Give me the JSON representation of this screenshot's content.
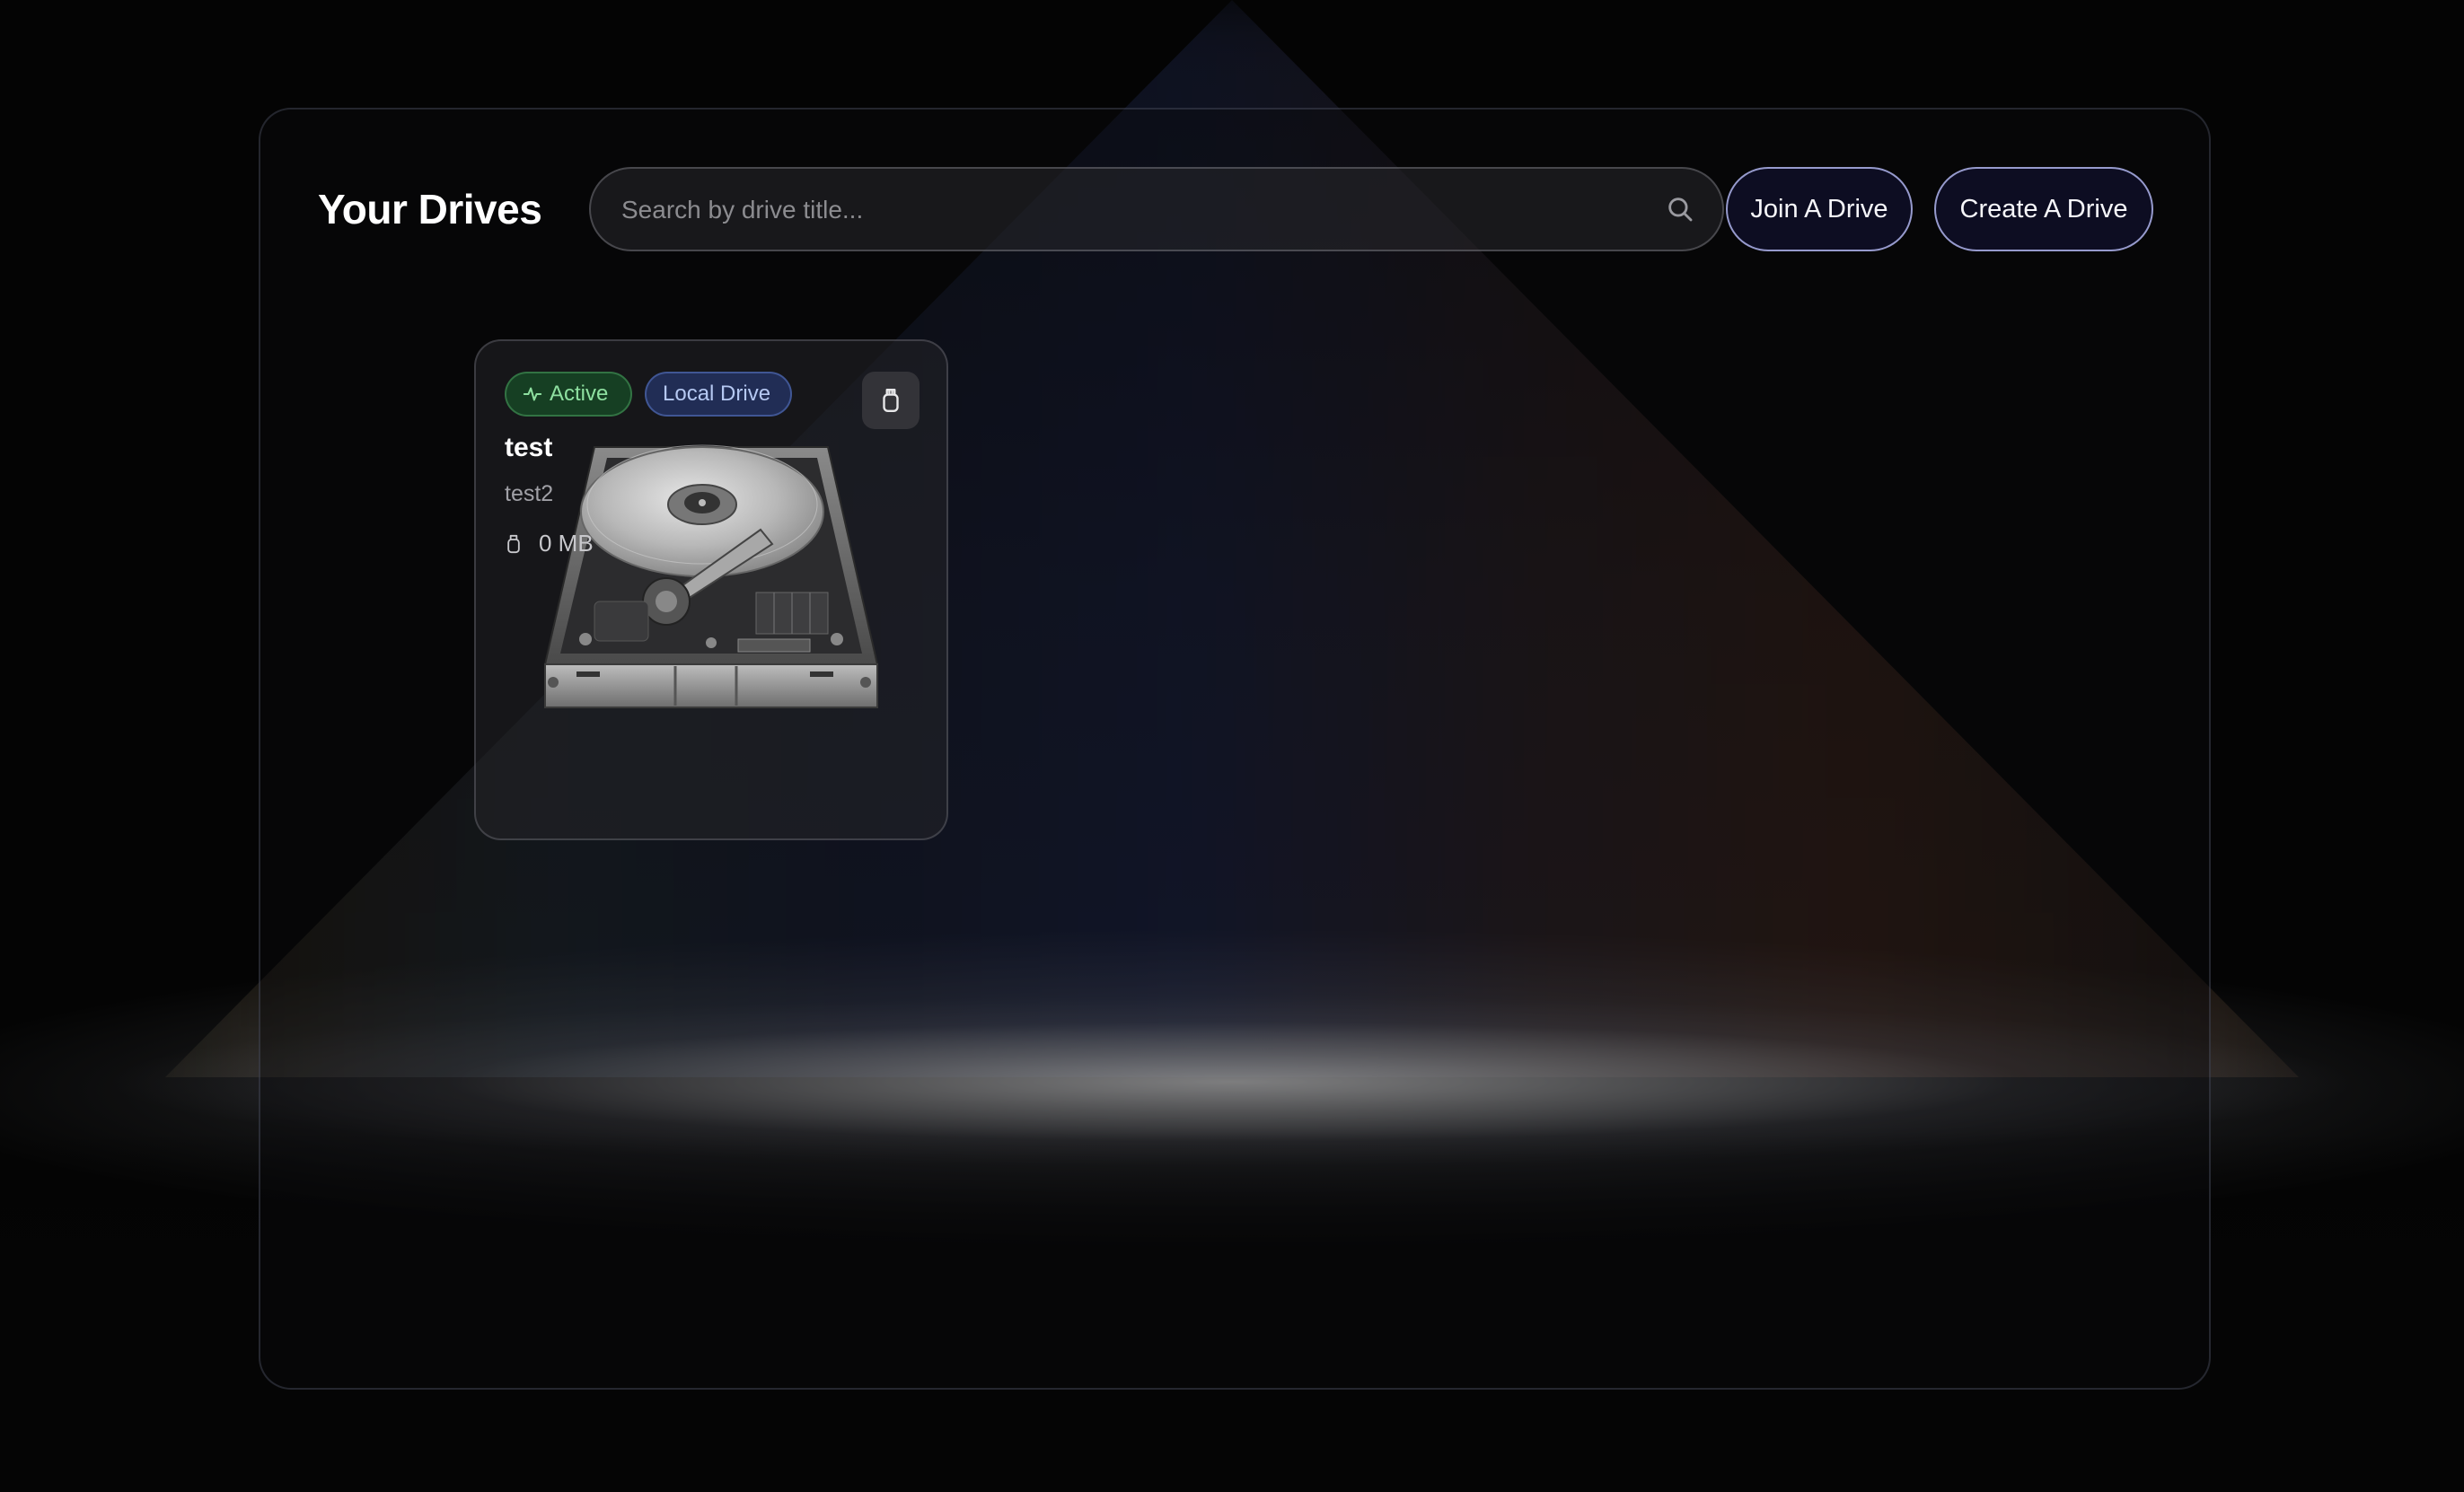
{
  "header": {
    "title": "Your Drives"
  },
  "search": {
    "placeholder": "Search by drive title..."
  },
  "buttons": {
    "join_label": "Join A Drive",
    "create_label": "Create A Drive"
  },
  "drives": [
    {
      "status": "Active",
      "type": "Local Drive",
      "title": "test",
      "description": "test2",
      "size": "0 MB",
      "icons": [
        "activity-icon",
        "usb-icon",
        "hard-drive-image"
      ]
    }
  ],
  "colors": {
    "accent_border": "#afb4eb",
    "button_bg": "#0e0e26",
    "active_badge": "#8ee0a0",
    "local_badge": "#b5c8f2"
  }
}
